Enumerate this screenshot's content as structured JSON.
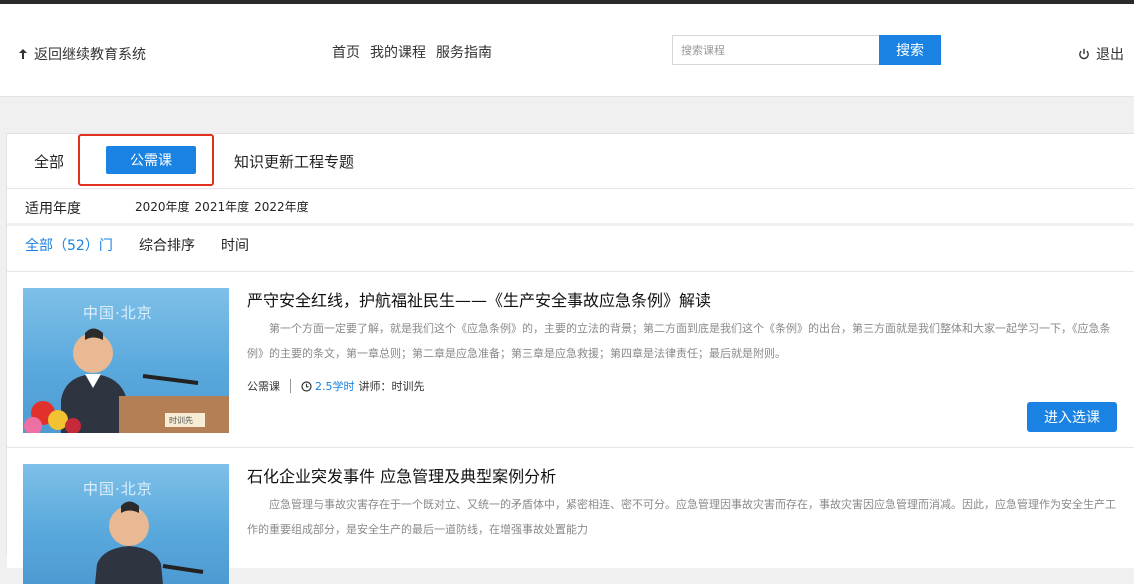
{
  "header": {
    "back_label": "返回继续教育系统",
    "nav": [
      "首页",
      "我的课程",
      "服务指南"
    ],
    "search_placeholder": "搜索课程",
    "search_button": "搜索",
    "logout_label": "退出"
  },
  "tabs": {
    "all": "全部",
    "public": "公需课",
    "topic": "知识更新工程专题",
    "selected": "公需课"
  },
  "filters": {
    "year_label": "适用年度",
    "years": [
      "2020年度",
      "2021年度",
      "2022年度"
    ]
  },
  "sort": {
    "count_label": "全部（52）门",
    "comprehensive": "综合排序",
    "time": "时间"
  },
  "courses": [
    {
      "title": "严守安全红线，护航福祉民生——《生产安全事故应急条例》解读",
      "description": "第一个方面一定要了解，就是我们这个《应急条例》的，主要的立法的背景；第二方面到底是我们这个《条例》的出台，第三方面就是我们整体和大家一起学习一下，《应急条例》的主要的条文，第一章总则；第二章是应急准备；第三章是应急救援；第四章是法律责任；最后就是附则。",
      "type": "公需课",
      "hours": "2.5学时",
      "lecturer": "讲师：时训先",
      "thumb_text": "中国·北京",
      "enroll": "进入选课"
    },
    {
      "title": "石化企业突发事件 应急管理及典型案例分析",
      "description": "应急管理与事故灾害存在于一个既对立、又统一的矛盾体中，紧密相连、密不可分。应急管理因事故灾害而存在，事故灾害因应急管理而消减。因此，应急管理作为安全生产工作的重要组成部分，是安全生产的最后一道防线，在增强事故处置能力",
      "thumb_text": "中国·北京"
    }
  ],
  "colors": {
    "accent": "#1a82e2",
    "highlight": "#e0301e"
  }
}
